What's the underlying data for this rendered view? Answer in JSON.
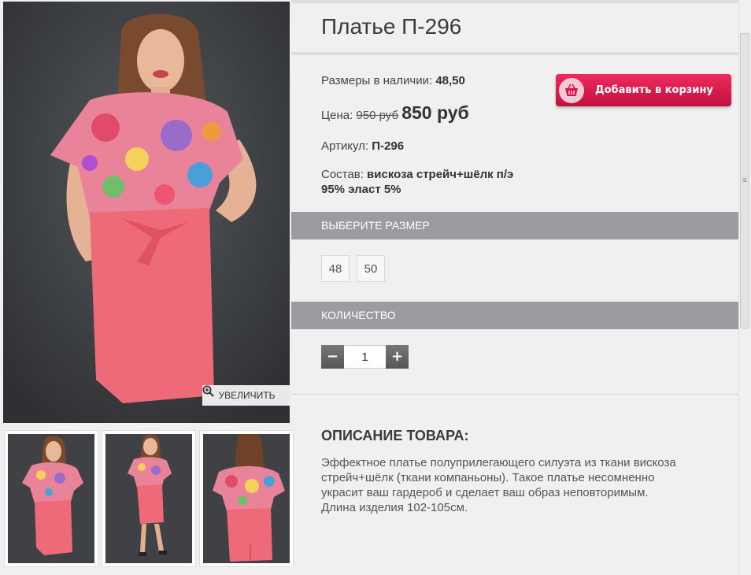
{
  "product": {
    "title": "Платье П-296",
    "sizes_label": "Размеры в наличии:",
    "sizes_value": "48,50",
    "price_label": "Цена:",
    "old_price": "950 руб",
    "new_price": "850 руб",
    "article_label": "Артикул:",
    "article_value": "П-296",
    "composition_label": "Состав:",
    "composition_line1": "вискоза стрейч+шёлк п/э",
    "composition_line2": "95% эласт 5%"
  },
  "cart_button": {
    "label": "Добавить в корзину",
    "icon": "basket-icon"
  },
  "gallery": {
    "zoom_label": "УВЕЛИЧИТЬ",
    "zoom_icon": "magnifier-plus-icon",
    "thumbnail_count": 3
  },
  "size_section": {
    "title": "ВЫБЕРИТЕ РАЗМЕР",
    "options": [
      "48",
      "50"
    ]
  },
  "quantity_section": {
    "title": "КОЛИЧЕСТВО",
    "minus": "−",
    "plus": "+",
    "value": "1"
  },
  "description": {
    "title": "ОПИСАНИЕ ТОВАРА:",
    "line1": "Эффектное платье полуприлегающего силуэта из ткани вискоза",
    "line2": "стрейч+шёлк (ткани компаньоны). Такое платье несомненно",
    "line3": "украсит ваш гардероб и сделает ваш образ неповторимым.",
    "line4": "Длина изделия 102-105см."
  },
  "colors": {
    "accent": "#d9164a",
    "section_bar": "#9a9ca0",
    "dress_skirt": "#ee6a78",
    "photo_background": "#3f4144"
  }
}
